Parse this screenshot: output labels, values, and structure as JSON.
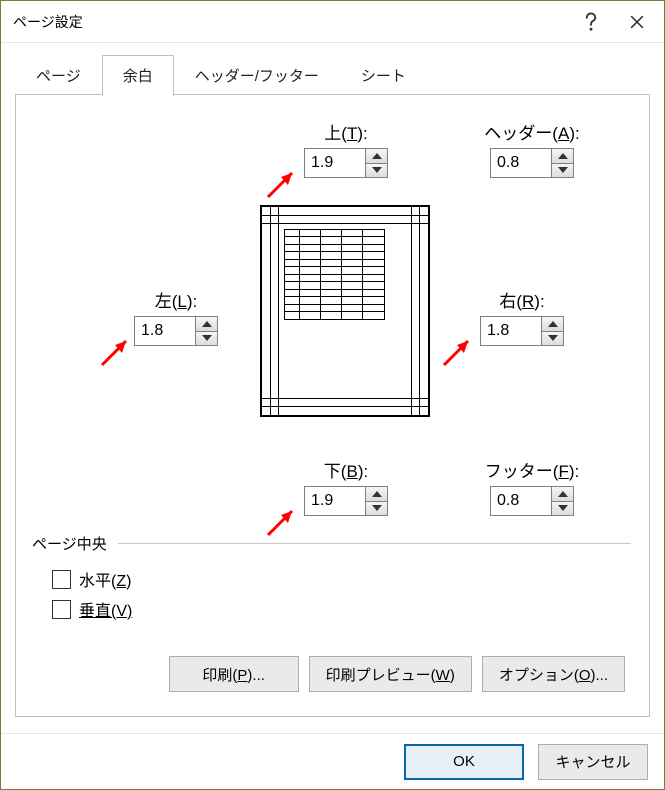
{
  "title": "ページ設定",
  "tabs": {
    "page": "ページ",
    "margins": "余白",
    "headerfooter": "ヘッダー/フッター",
    "sheet": "シート"
  },
  "margins": {
    "top": {
      "label_prefix": "上(",
      "key": "T",
      "label_suffix": "):",
      "value": "1.9"
    },
    "header": {
      "label_prefix": "ヘッダー(",
      "key": "A",
      "label_suffix": "):",
      "value": "0.8"
    },
    "left": {
      "label_prefix": "左(",
      "key": "L",
      "label_suffix": "):",
      "value": "1.8"
    },
    "right": {
      "label_prefix": "右(",
      "key": "R",
      "label_suffix": "):",
      "value": "1.8"
    },
    "bottom": {
      "label_prefix": "下(",
      "key": "B",
      "label_suffix": "):",
      "value": "1.9"
    },
    "footer": {
      "label_prefix": "フッター(",
      "key": "F",
      "label_suffix": "):",
      "value": "0.8"
    }
  },
  "center_section": {
    "title": "ページ中央",
    "horizontal": {
      "prefix": "水平(",
      "key": "Z",
      "suffix": ")"
    },
    "vertical": {
      "prefix": "垂直(",
      "key": "V",
      "suffix": ")"
    }
  },
  "buttons": {
    "print": {
      "prefix": "印刷(",
      "key": "P",
      "suffix": ")..."
    },
    "preview": {
      "prefix": "印刷プレビュー(",
      "key": "W",
      "suffix": ")"
    },
    "options": {
      "prefix": "オプション(",
      "key": "O",
      "suffix": ")..."
    },
    "ok": "OK",
    "cancel": "キャンセル"
  },
  "annotation_color": "#ff0000"
}
